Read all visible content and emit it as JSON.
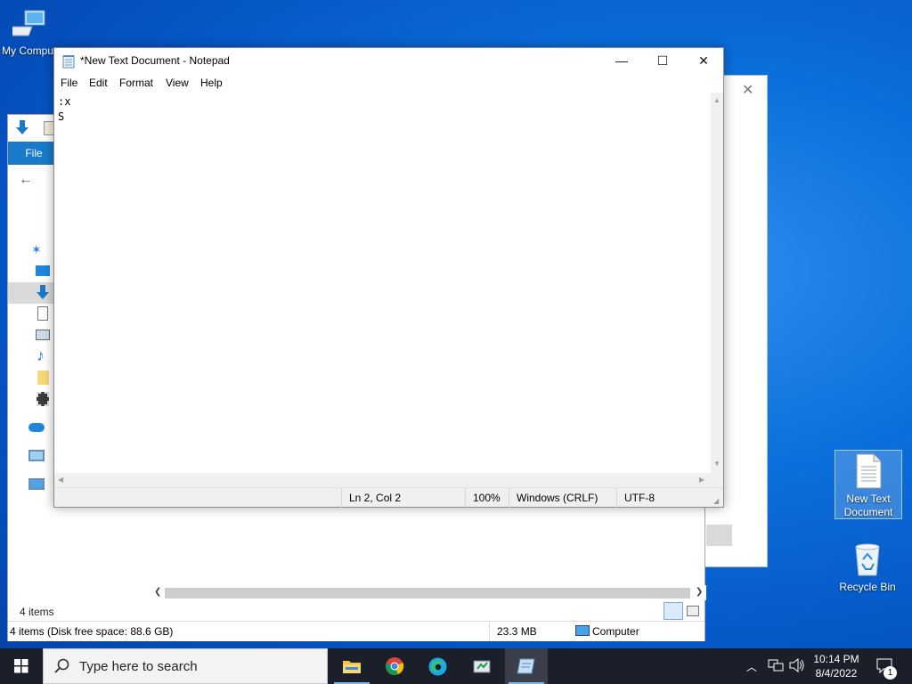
{
  "desktop": {
    "icons": {
      "my_computer": "My Computer",
      "new_text_document": "New Text\nDocument",
      "recycle_bin": "Recycle Bin"
    },
    "wallpaper_color": "#0a6fdc"
  },
  "explorer": {
    "file_tab": "File",
    "item_count": "4 items",
    "status_left": "4 items (Disk free space: 88.6 GB)",
    "status_size": "23.3 MB",
    "status_location": "Computer",
    "accent": "#1979ca"
  },
  "notepad": {
    "title": "*New Text Document - Notepad",
    "menu": [
      "File",
      "Edit",
      "Format",
      "View",
      "Help"
    ],
    "content": ":x\nS",
    "status": {
      "position": "Ln 2, Col 2",
      "zoom": "100%",
      "line_endings": "Windows (CRLF)",
      "encoding": "UTF-8"
    }
  },
  "taskbar": {
    "search_placeholder": "Type here to search",
    "time": "10:14 PM",
    "date": "8/4/2022",
    "notification_count": "1",
    "apps": [
      "file-explorer",
      "chrome",
      "edge",
      "app",
      "notepad"
    ]
  }
}
